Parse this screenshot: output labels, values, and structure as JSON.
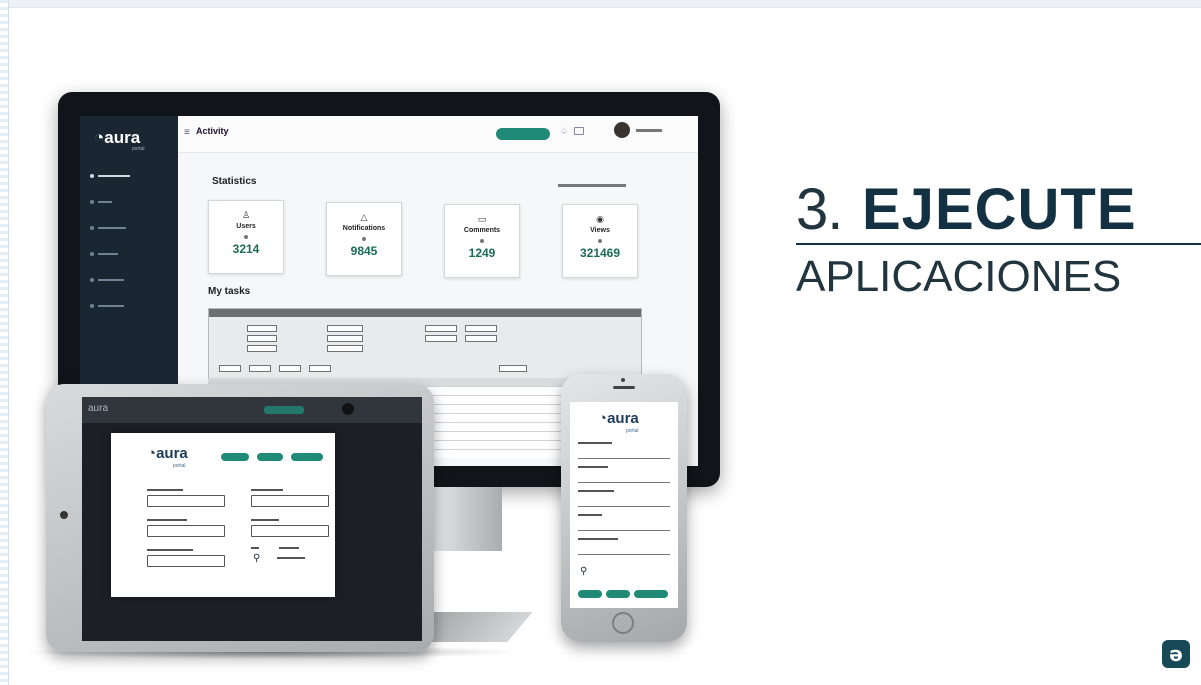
{
  "heading": {
    "number": "3.",
    "word": "EJECUTE",
    "subtitle": "APLICACIONES"
  },
  "monitor": {
    "brand": "aura",
    "brand_sub": "portal",
    "header_title": "Activity",
    "statistics_title": "Statistics",
    "tasks_title": "My tasks",
    "stats": [
      {
        "icon": "user-icon",
        "glyph": "♙",
        "label": "Users",
        "value": "3214"
      },
      {
        "icon": "bell-icon",
        "glyph": "△",
        "label": "Notifications",
        "value": "9845"
      },
      {
        "icon": "comment-icon",
        "glyph": "▭",
        "label": "Comments",
        "value": "1249"
      },
      {
        "icon": "eye-icon",
        "glyph": "◉",
        "label": "Views",
        "value": "321469"
      }
    ]
  },
  "tablet": {
    "brand": "aura",
    "dialog_brand": "aura",
    "dialog_brand_sub": "portal"
  },
  "phone": {
    "brand": "aura",
    "brand_sub": "portal"
  },
  "colors": {
    "accent": "#1f8a76",
    "heading": "#133142",
    "sidebar": "#1a2733"
  }
}
